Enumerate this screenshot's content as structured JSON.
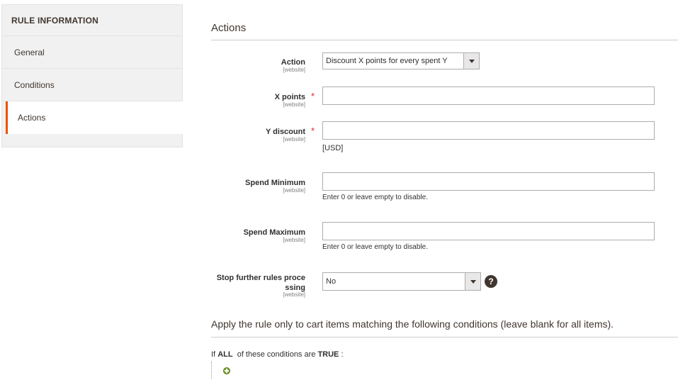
{
  "sidebar": {
    "title": "RULE INFORMATION",
    "items": [
      {
        "label": "General"
      },
      {
        "label": "Conditions"
      },
      {
        "label": "Actions"
      }
    ]
  },
  "main": {
    "section_title": "Actions",
    "fields": {
      "action": {
        "label": "Action",
        "scope": "[website]",
        "value": "Discount X points for every spent Y"
      },
      "x_points": {
        "label": "X points",
        "scope": "[website]",
        "required": "*",
        "value": ""
      },
      "y_discount": {
        "label": "Y discount",
        "scope": "[website]",
        "required": "*",
        "value": "",
        "note": "[USD]"
      },
      "spend_min": {
        "label": "Spend Minimum",
        "scope": "[website]",
        "value": "",
        "note": "Enter 0 or leave empty to disable."
      },
      "spend_max": {
        "label": "Spend Maximum",
        "scope": "[website]",
        "value": "",
        "note": "Enter 0 or leave empty to disable."
      },
      "stop_rules": {
        "label_line1": "Stop further rules proce",
        "label_line2": "ssing",
        "scope": "[website]",
        "value": "No"
      }
    },
    "help_icon": "?",
    "apply_title": "Apply the rule only to cart items matching the following conditions (leave blank for all items).",
    "conditions": {
      "prefix": "If",
      "aggregator": "ALL",
      "middle": "of these conditions are",
      "value": "TRUE",
      "suffix": ":"
    }
  },
  "colors": {
    "accent": "#eb5202",
    "required": "#e22626",
    "add_icon": "#79a22e"
  }
}
